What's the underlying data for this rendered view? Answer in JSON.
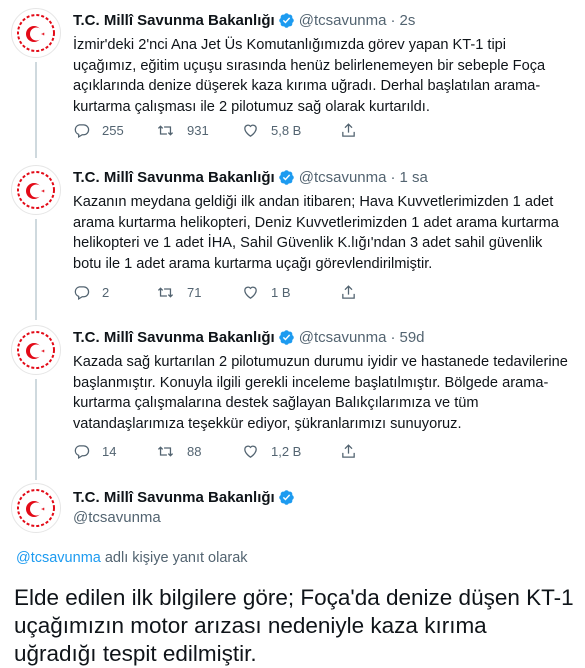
{
  "account": {
    "name": "T.C. Millî Savunma Bakanlığı",
    "handle": "@tcsavunma"
  },
  "tweets": [
    {
      "time": "2s",
      "text": "İzmir'deki 2'nci Ana Jet Üs Komutanlığımızda görev yapan KT-1 tipi uçağımız, eğitim uçuşu sırasında henüz belirlenemeyen bir sebeple Foça açıklarında denize düşerek kaza kırıma uğradı. Derhal başlatılan arama-kurtarma çalışması ile 2 pilotumuz sağ olarak kurtarıldı.",
      "replies": "255",
      "retweets": "931",
      "likes": "5,8 B"
    },
    {
      "time": "1 sa",
      "text": "Kazanın meydana geldiği ilk andan itibaren; Hava Kuvvetlerimizden 1 adet arama kurtarma helikopteri, Deniz Kuvvetlerimizden 1 adet arama kurtarma helikopteri ve 1 adet İHA, Sahil Güvenlik K.lığı'ndan 3 adet sahil güvenlik botu ile 1 adet arama kurtarma uçağı görevlendirilmiştir.",
      "replies": "2",
      "retweets": "71",
      "likes": "1 B"
    },
    {
      "time": "59d",
      "text": "Kazada sağ kurtarılan 2 pilotumuzun durumu iyidir ve hastanede tedavilerine başlanmıştır. Konuyla ilgili gerekli inceleme başlatılmıştır. Bölgede arama-kurtarma çalışmalarına destek sağlayan Balıkçılarımıza ve tüm vatandaşlarımıza teşekkür ediyor, şükranlarımızı sunuyoruz.",
      "replies": "14",
      "retweets": "88",
      "likes": "1,2 B"
    }
  ],
  "focused": {
    "reply_handle": "@tcsavunma",
    "reply_suffix": " adlı kişiye yanıt olarak",
    "text": "Elde edilen ilk bilgilere göre; Foça'da denize düşen KT-1 uçağımızın motor arızası nedeniyle kaza kırıma uğradığı tespit edilmiştir."
  },
  "colors": {
    "accent": "#1d9bf0",
    "secondary_text": "#536471",
    "emblem_red": "#e30a17",
    "thread_line": "#cfd9de"
  }
}
